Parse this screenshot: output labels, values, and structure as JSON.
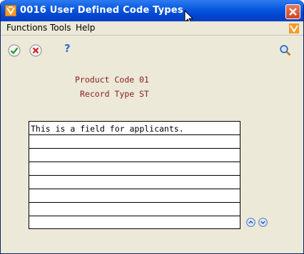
{
  "window": {
    "title": "0016   User Defined Code Types"
  },
  "menu": {
    "items": [
      "Functions",
      "Tools",
      "Help"
    ]
  },
  "toolbar": {
    "ok_icon": "checkmark-icon",
    "cancel_icon": "cancel-icon",
    "help_label": "?",
    "search_icon": "magnifier-icon"
  },
  "form": {
    "product_code_label": "Product Code",
    "product_code_value": "01",
    "record_type_label": "Record Type",
    "record_type_value": "ST"
  },
  "grid": {
    "rows": [
      "This is a field for applicants.",
      "",
      "",
      "",
      "",
      "",
      "",
      ""
    ]
  },
  "colors": {
    "title_bar": "#0047d3",
    "label_text": "#8b2020",
    "background": "#ece9d8"
  }
}
